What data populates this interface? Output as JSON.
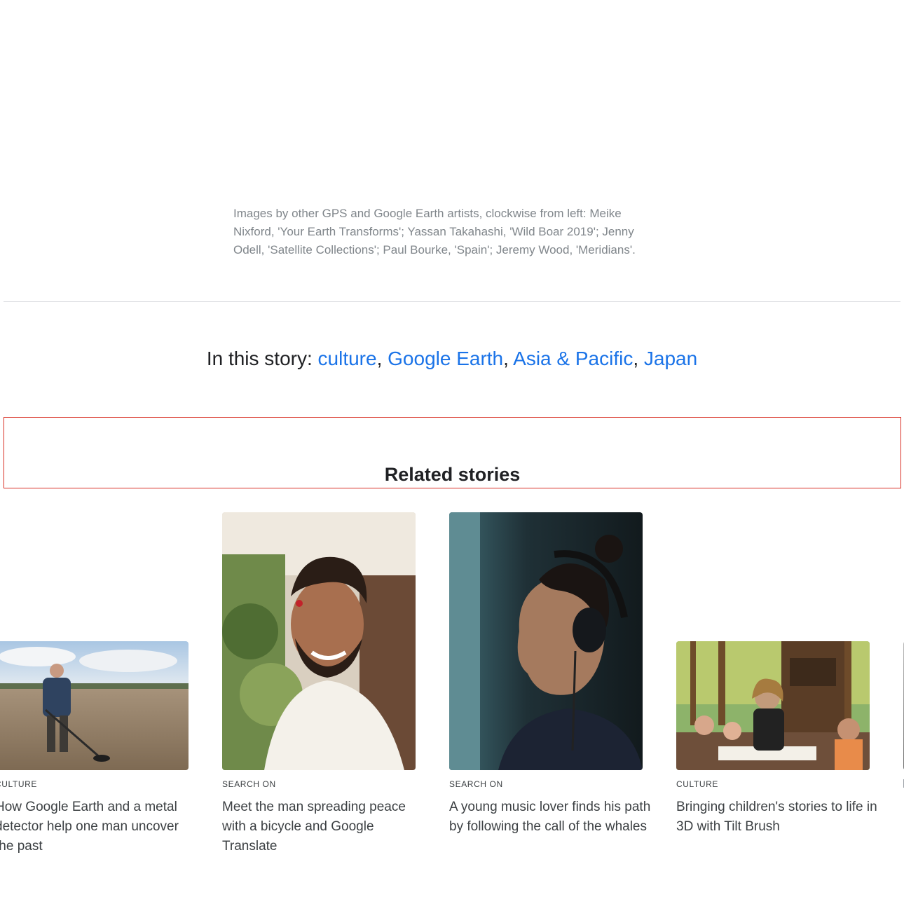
{
  "caption": {
    "text": "Images by other GPS and Google Earth artists, clockwise from left: Meike Nixford, 'Your Earth Transforms'; Yassan Takahashi, 'Wild Boar 2019'; Jenny Odell, 'Satellite Collections'; Paul Bourke, 'Spain'; Jeremy Wood, 'Meridians'."
  },
  "tags": {
    "prefix": "In this story:",
    "items": [
      "culture",
      "Google Earth",
      "Asia & Pacific",
      "Japan"
    ],
    "link_color": "#1a73e8"
  },
  "related": {
    "title": "Related stories",
    "cards": [
      {
        "eyebrow": "CULTURE",
        "headline": "How Google Earth and a metal detector help one man uncover the past",
        "image": "man-with-metal-detector-photo"
      },
      {
        "eyebrow": "SEARCH ON",
        "headline": "Meet the man spreading peace with a bicycle and Google Translate",
        "image": "smiling-man-portrait-photo"
      },
      {
        "eyebrow": "SEARCH ON",
        "headline": "A young music lover finds his path by following the call of the whales",
        "image": "man-with-headphones-photo"
      },
      {
        "eyebrow": "CULTURE",
        "headline": "Bringing children's stories to life in 3D with Tilt Brush",
        "image": "children-storytime-photo"
      }
    ]
  },
  "colors": {
    "text": "#202124",
    "secondary_text": "#80868b",
    "divider": "#dadce0",
    "highlight_border": "#d93025"
  }
}
